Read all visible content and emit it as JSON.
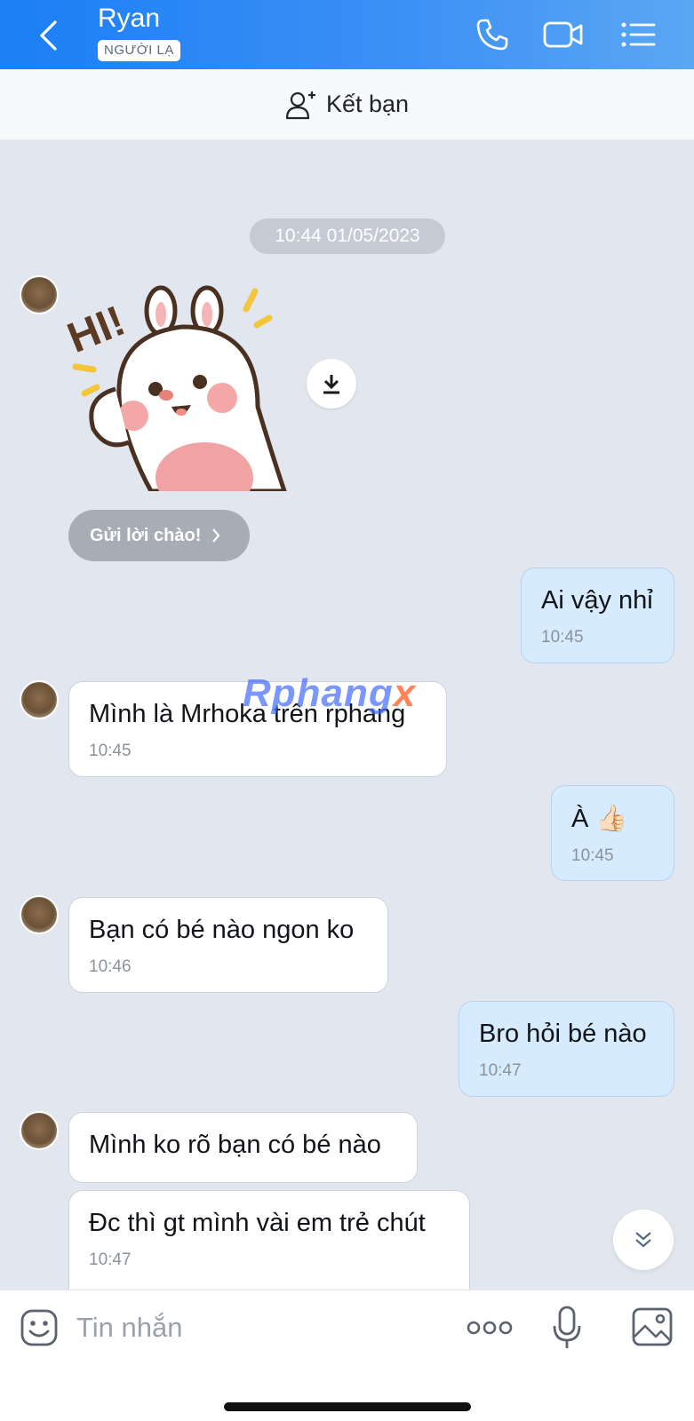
{
  "header": {
    "contact_name": "Ryan",
    "badge": "NGƯỜI LẠ"
  },
  "add_friend": {
    "label": "Kết bạn"
  },
  "chat": {
    "date": "10:44 01/05/2023",
    "greet_button": "Gửi lời chào!",
    "messages": [
      {
        "side": "out",
        "text": "Ai vậy nhỉ",
        "time": "10:45"
      },
      {
        "side": "in",
        "text": "Mình là Mrhoka trên rphang",
        "time": "10:45"
      },
      {
        "side": "out",
        "text": "À 👍🏻",
        "time": "10:45"
      },
      {
        "side": "in",
        "text": "Bạn có bé nào ngon ko",
        "time": "10:46"
      },
      {
        "side": "out",
        "text": "Bro hỏi bé nào",
        "time": "10:47"
      },
      {
        "side": "in",
        "text": "Mình ko rõ bạn có bé nào",
        "time": ""
      },
      {
        "side": "in",
        "text": "Đc thì gt mình vài em trẻ chút",
        "time": "10:47"
      }
    ],
    "watermark": {
      "main": "Rphang",
      "suffix": "x"
    },
    "sticker_text": "HI!"
  },
  "input": {
    "placeholder": "Tin nhắn"
  },
  "colors": {
    "header_blue": "#1b7ff5",
    "chat_bg": "#e2e7ef",
    "out_bubble": "#d6ebfd",
    "in_bubble": "#ffffff"
  },
  "icons": [
    "back-icon",
    "phone-icon",
    "video-call-icon",
    "menu-list-icon",
    "add-user-icon",
    "download-icon",
    "chevron-right-icon",
    "double-chevron-down-icon",
    "emoji-icon",
    "more-icon",
    "microphone-icon",
    "image-icon"
  ]
}
